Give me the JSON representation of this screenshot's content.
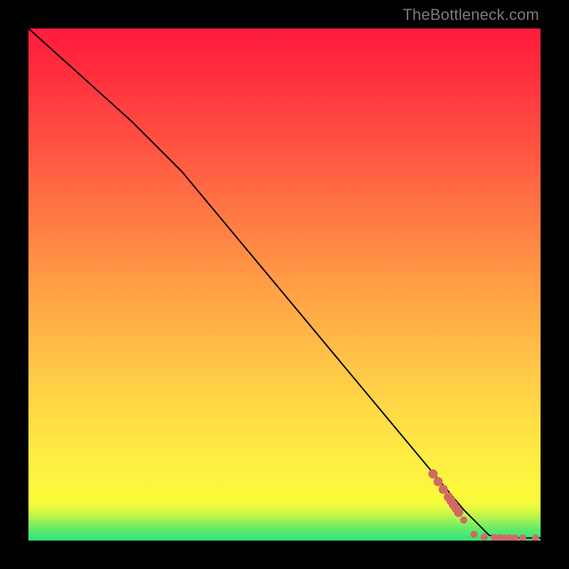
{
  "watermark": "TheBottleneck.com",
  "chart_data": {
    "type": "line",
    "title": "",
    "xlabel": "",
    "ylabel": "",
    "xlim": [
      0,
      100
    ],
    "ylim": [
      0,
      100
    ],
    "series": [
      {
        "name": "curve",
        "x": [
          0,
          10,
          20,
          30,
          40,
          50,
          60,
          70,
          80,
          85,
          90,
          95,
          100
        ],
        "y": [
          100,
          91,
          82,
          72,
          60,
          48,
          36,
          24,
          12,
          6,
          1,
          0.5,
          0.5
        ]
      }
    ],
    "marker_points": {
      "name": "highlighted-segment",
      "color": "#d06a65",
      "x": [
        79,
        80,
        81,
        82,
        82.5,
        83,
        83.5,
        84,
        85,
        87,
        89,
        91,
        92,
        93,
        94,
        95,
        96.5,
        99
      ],
      "y": [
        13,
        11.5,
        10,
        8.5,
        7.8,
        7,
        6.3,
        5.5,
        4,
        1.2,
        0.7,
        0.6,
        0.55,
        0.5,
        0.5,
        0.5,
        0.5,
        0.5
      ]
    }
  }
}
